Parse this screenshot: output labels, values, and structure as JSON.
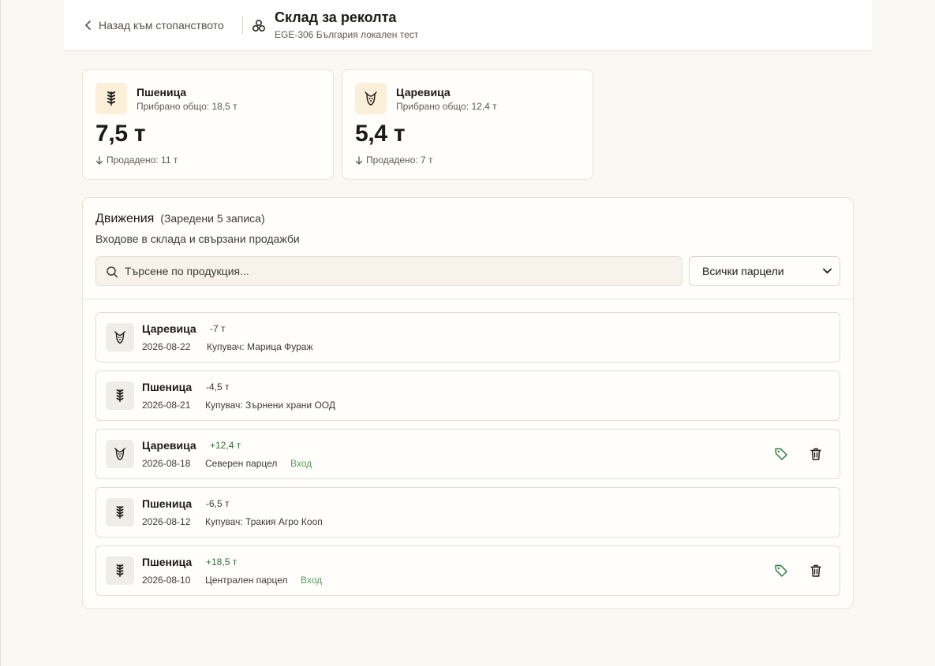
{
  "header": {
    "back_label": "Назад към стопанството",
    "title": "Склад за реколта",
    "subtitle": "EGE-306 България локален тест"
  },
  "stats": [
    {
      "name": "Пшеница",
      "total": "Прибрано общо: 18,5 т",
      "value": "7,5 т",
      "sold": "Продадено: 11 т",
      "icon": "wheat-icon"
    },
    {
      "name": "Царевица",
      "total": "Прибрано общо: 12,4 т",
      "value": "5,4 т",
      "sold": "Продадено: 7 т",
      "icon": "corn-icon"
    }
  ],
  "movements": {
    "title": "Движения",
    "count": "(Заредени 5 записа)",
    "description": "Входове в склада и свързани продажби",
    "search_placeholder": "Търсене по продукция...",
    "filter_selected": "Всички парцели",
    "rows": [
      {
        "name": "Царевица",
        "qty": "-7 т",
        "date": "2026-08-22",
        "detail": "Купувач: Марица Фураж",
        "badge": "",
        "icon": "corn-icon"
      },
      {
        "name": "Пшеница",
        "qty": "-4,5 т",
        "date": "2026-08-21",
        "detail": "Купувач: Зърнени храни ООД",
        "badge": "",
        "icon": "wheat-icon"
      },
      {
        "name": "Царевица",
        "qty": "+12,4 т",
        "date": "2026-08-18",
        "detail": "Северен парцел",
        "badge": "Вход",
        "icon": "corn-icon"
      },
      {
        "name": "Пшеница",
        "qty": "-6,5 т",
        "date": "2026-08-12",
        "detail": "Купувач: Тракия Агро Кооп",
        "badge": "",
        "icon": "wheat-icon"
      },
      {
        "name": "Пшеница",
        "qty": "+18,5 т",
        "date": "2026-08-10",
        "detail": "Централен парцел",
        "badge": "Вход",
        "icon": "wheat-icon"
      }
    ]
  },
  "colors": {
    "background": "#faf8f2",
    "positive_qty": "#2f6b3a",
    "badge_green": "#5a9a64",
    "tag_icon": "#2f7a45"
  }
}
